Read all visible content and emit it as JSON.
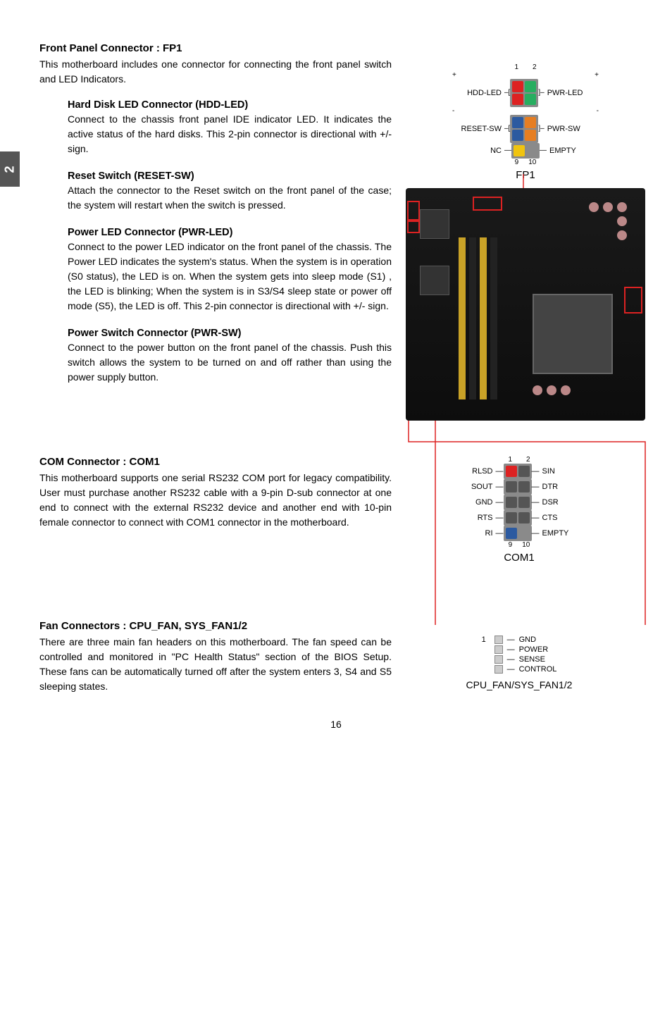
{
  "sideTab": "2",
  "fp1": {
    "heading": "Front Panel Connector : FP1",
    "intro": "This motherboard includes one connector for connecting the front panel switch and LED Indicators.",
    "hdd": {
      "title": "Hard Disk LED Connector (HDD-LED)",
      "body": "Connect to the chassis front panel IDE indicator LED. It indicates the active status of the hard disks. This 2-pin connector is directional with +/- sign."
    },
    "reset": {
      "title": "Reset Switch (RESET-SW)",
      "body": "Attach the connector to the Reset switch on the front panel of the case; the system will restart when the switch is pressed."
    },
    "pwrled": {
      "title": "Power LED Connector (PWR-LED)",
      "body": "Connect to the power LED indicator on the front panel of the chassis. The Power LED indicates the system's status. When the system is in operation (S0 status), the LED is on. When the system gets into sleep mode (S1) , the LED is blinking; When the system is in S3/S4 sleep state or power off mode (S5), the LED is off. This 2-pin connector is directional with +/- sign."
    },
    "pwrsw": {
      "title": "Power Switch Connector (PWR-SW)",
      "body": "Connect to the power button on the front panel of the chassis. Push this switch allows the system to be turned on and off rather than using the power supply button."
    },
    "diagram": {
      "topNums": {
        "left": "1",
        "right": "2"
      },
      "botNums": {
        "left": "9",
        "right": "10"
      },
      "plusLeft": "+",
      "minusLeft": "-",
      "plusRight": "+",
      "minusRight": "-",
      "rows": [
        {
          "left": "HDD-LED",
          "right": "PWR-LED"
        },
        {
          "left": "RESET-SW",
          "right": "PWR-SW"
        },
        {
          "left": "NC",
          "right": "EMPTY"
        }
      ],
      "title": "FP1"
    }
  },
  "com1": {
    "heading": "COM Connector : COM1",
    "body": "This motherboard supports one serial RS232 COM port for legacy compatibility. User must purchase another RS232 cable with a 9-pin D-sub connector at one end to connect with the external RS232 device and another end with 10-pin female connector to connect with COM1 connector in the motherboard.",
    "diagram": {
      "topNums": {
        "left": "1",
        "right": "2"
      },
      "botNums": {
        "left": "9",
        "right": "10"
      },
      "rows": [
        {
          "left": "RLSD",
          "right": "SIN"
        },
        {
          "left": "SOUT",
          "right": "DTR"
        },
        {
          "left": "GND",
          "right": "DSR"
        },
        {
          "left": "RTS",
          "right": "CTS"
        },
        {
          "left": "RI",
          "right": "EMPTY"
        }
      ],
      "title": "COM1"
    }
  },
  "fan": {
    "heading": "Fan Connectors : CPU_FAN, SYS_FAN1/2",
    "body": "There are three main fan headers on this motherboard. The fan speed can be controlled and monitored in \"PC Health Status\" section of the BIOS Setup. These fans can be automatically turned off after the system enters   3, S4 and S5 sleeping states.",
    "diagram": {
      "one": "1",
      "pins": [
        "GND",
        "POWER",
        "SENSE",
        "CONTROL"
      ],
      "title": "CPU_FAN/SYS_FAN1/2"
    }
  },
  "pageNum": "16"
}
